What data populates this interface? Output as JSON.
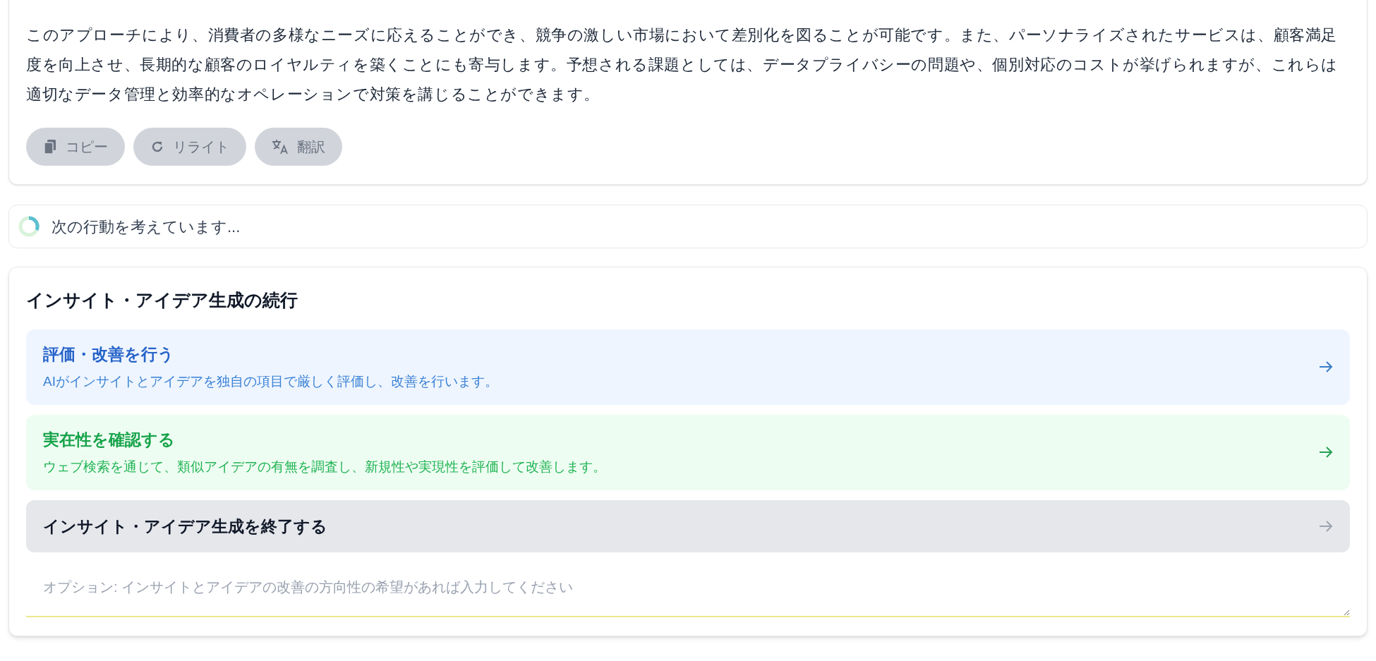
{
  "response": {
    "text": "このアプローチにより、消費者の多様なニーズに応えることができ、競争の激しい市場において差別化を図ることが可能です。また、パーソナライズされたサービスは、顧客満足度を向上させ、長期的な顧客のロイヤルティを築くことにも寄与します。予想される課題としては、データプライバシーの問題や、個別対応のコストが挙げられますが、これらは適切なデータ管理と効率的なオペレーションで対策を講じることができます。",
    "actions": [
      {
        "kind": "copy",
        "label": "コピー"
      },
      {
        "kind": "rewrite",
        "label": "リライト"
      },
      {
        "kind": "translate",
        "label": "翻訳"
      }
    ]
  },
  "status": {
    "text": "次の行動を考えています..."
  },
  "next_steps": {
    "title": "インサイト・アイデア生成の続行",
    "options": [
      {
        "kind": "evaluate",
        "title": "評価・改善を行う",
        "description": "AIがインサイトとアイデアを独自の項目で厳しく評価し、改善を行います。"
      },
      {
        "kind": "verify",
        "title": "実在性を確認する",
        "description": "ウェブ検索を通じて、類似アイデアの有無を調査し、新規性や実現性を評価して改善します。"
      },
      {
        "kind": "finish",
        "title": "インサイト・アイデア生成を終了する"
      }
    ],
    "input": {
      "placeholder": "オプション: インサイトとアイデアの改善の方向性の希望があれば入力してください"
    }
  }
}
